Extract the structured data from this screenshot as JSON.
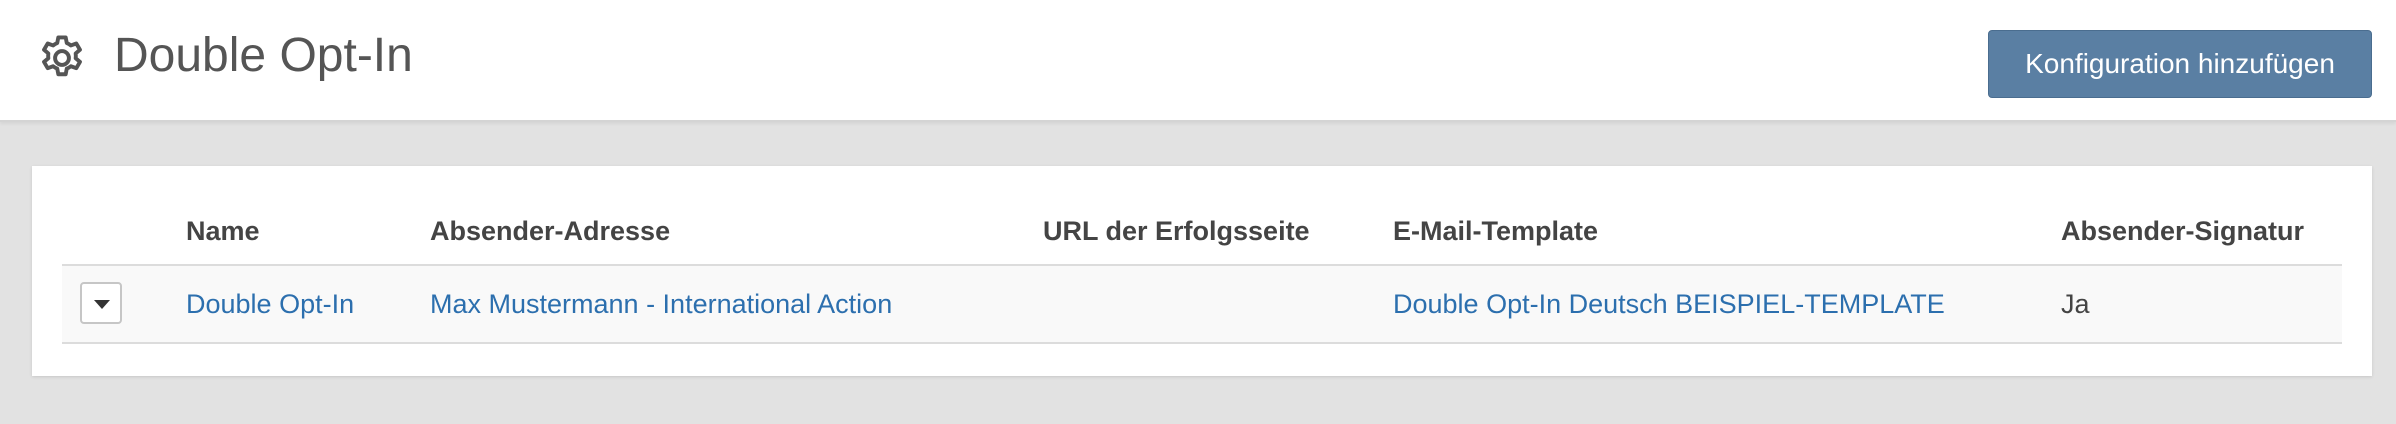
{
  "header": {
    "title": "Double Opt-In",
    "add_button_label": "Konfiguration hinzufügen"
  },
  "table": {
    "columns": [
      "Name",
      "Absender-Adresse",
      "URL der Erfolgsseite",
      "E-Mail-Template",
      "Absender-Signatur"
    ],
    "rows": [
      {
        "name": "Double Opt-In",
        "sender": "Max Mustermann - International Action",
        "success_url": "",
        "template": "Double Opt-In Deutsch BEISPIEL-TEMPLATE",
        "signature": "Ja"
      }
    ]
  },
  "icons": {
    "title_icon": "gear-icon",
    "row_toggle_icon": "caret-down-icon"
  },
  "colors": {
    "accent_button": "#5a7fa3",
    "link": "#2c6fae"
  }
}
